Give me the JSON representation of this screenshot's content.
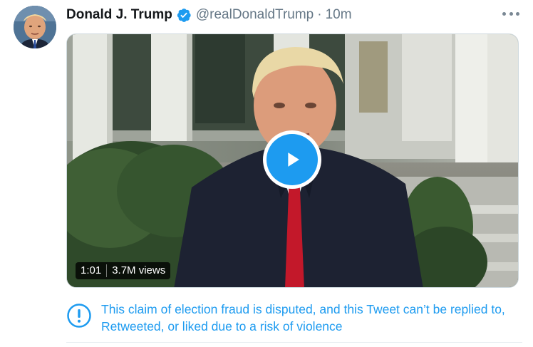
{
  "tweet": {
    "display_name": "Donald J. Trump",
    "handle": "@realDonaldTrump",
    "separator": "·",
    "timestamp": "10m",
    "verified": true
  },
  "video": {
    "duration": "1:01",
    "views": "3.7M views"
  },
  "notice": {
    "text": "This claim of election fraud is disputed, and this Tweet can’t be replied to, Retweeted, or liked due to a risk of violence"
  },
  "icons": {
    "verified": "verified-badge-icon",
    "more": "more-options-icon",
    "play": "play-icon",
    "notice": "exclamation-circle-icon"
  },
  "colors": {
    "accent": "#1d9bf0",
    "text_primary": "#14171a",
    "text_secondary": "#657786"
  }
}
